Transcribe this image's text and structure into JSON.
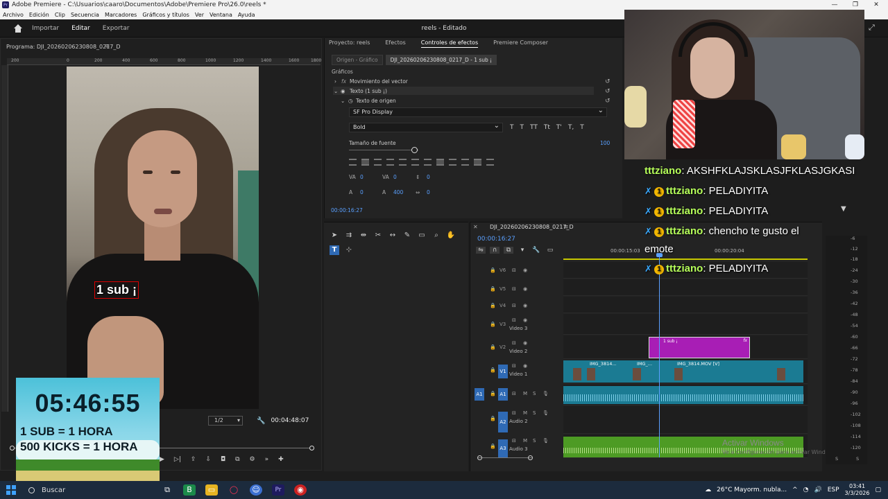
{
  "window": {
    "title": "Adobe Premiere - C:\\Usuarios\\caaro\\Documentos\\Adobe\\Premiere Pro\\26.0\\reels *"
  },
  "menu": [
    "Archivo",
    "Edición",
    "Clip",
    "Secuencia",
    "Marcadores",
    "Gráficos y títulos",
    "Ver",
    "Ventana",
    "Ayuda"
  ],
  "workspace": {
    "tabs": [
      "Importar",
      "Editar",
      "Exportar"
    ],
    "active": "Editar",
    "doc_status": "reels - Editado"
  },
  "program": {
    "title": "Programa: DJI_20260206230808_0217_D",
    "ruler": [
      "200",
      "0",
      "200",
      "400",
      "600",
      "800",
      "1000",
      "1200",
      "1400",
      "1600",
      "1800",
      "2000"
    ],
    "zoom": "1/2",
    "timecode": "00:04:48:07",
    "caption": "1 sub ¡"
  },
  "timer_overlay": {
    "time": "05:46:55",
    "line1": "1 SUB = 1 HORA",
    "line2": "500 KICKS = 1 HORA"
  },
  "effects": {
    "tabs": [
      "Proyecto: reels",
      "Efectos",
      "Controles de efectos",
      "Premiere Composer"
    ],
    "source_tabs": [
      "Origen - Gráfico",
      "DJI_20260206230808_0217_D - 1 sub ¡"
    ],
    "section": "Gráficos",
    "row_vector": "Movimiento del vector",
    "row_text": "Texto (1 sub ¡)",
    "row_source_text": "Texto de origen",
    "font_family": "SF Pro Display",
    "font_style": "Bold",
    "font_size_label": "Tamaño de fuente",
    "font_size_value": "100",
    "metrics": {
      "kerning": "0",
      "tracking": "0",
      "leading": "0",
      "baseline": "0",
      "tsume": "400",
      "unknown": "0"
    },
    "timecode": "00:00:16:27",
    "style_buttons": [
      "T",
      "T",
      "TT",
      "Tt",
      "T'",
      "T,",
      "T"
    ]
  },
  "timeline": {
    "title": "DJI_20260206230808_0217_D",
    "timecode": "00:00:16:27",
    "ruler": [
      "00:00:15:03",
      "00:00:20:04"
    ],
    "tracks": [
      {
        "id": "V6",
        "label": ""
      },
      {
        "id": "V5",
        "label": ""
      },
      {
        "id": "V4",
        "label": ""
      },
      {
        "id": "V3",
        "label": "Video 3"
      },
      {
        "id": "V2",
        "label": "Video 2"
      },
      {
        "id": "V1",
        "label": "Video 1"
      },
      {
        "id": "A1",
        "label": ""
      },
      {
        "id": "A2",
        "label": "Audio 2"
      },
      {
        "id": "A3",
        "label": "Audio 3"
      }
    ],
    "clips": {
      "sub": "1 sub ¡",
      "v1a": "IMG_3814...",
      "v1b": "IMG_...",
      "v1c": "IMG_3814.MOV [V]"
    }
  },
  "meter": [
    "-6",
    "-12",
    "-18",
    "-24",
    "-30",
    "-36",
    "-42",
    "-48",
    "-54",
    "-60",
    "-66",
    "-72",
    "-78",
    "-84",
    "-90",
    "-96",
    "-102",
    "-108",
    "-114",
    "-120"
  ],
  "meter_bottom": [
    "S",
    "S"
  ],
  "watermark": {
    "title": "Activar Windows",
    "sub": "Ve a Configuración para activar Windows."
  },
  "chat": [
    {
      "user": "tttziano",
      "text": ": AKSHFKLAJSKLASJFKLASJGKASI",
      "badges": false
    },
    {
      "user": "tttziano",
      "text": ": PELADIYITA",
      "badges": true
    },
    {
      "user": "tttziano",
      "text": ": PELADIYITA",
      "badges": true
    },
    {
      "user": "tttziano",
      "text": ": chencho te gusto el",
      "badges": true
    },
    {
      "user": "",
      "text": "emote",
      "badges": false
    },
    {
      "user": "tttziano",
      "text": ": PELADIYITA",
      "badges": true
    }
  ],
  "taskbar": {
    "search": "Buscar",
    "weather": "26°C  Mayorm. nubla...",
    "lang": "ESP",
    "time": "03:41",
    "date": "3/3/2026"
  }
}
